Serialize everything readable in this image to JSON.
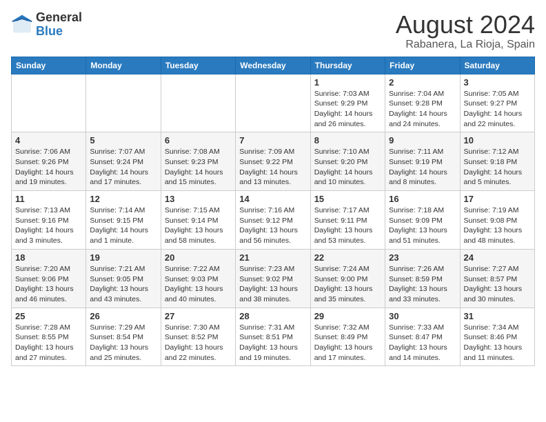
{
  "header": {
    "logo_general": "General",
    "logo_blue": "Blue",
    "month_year": "August 2024",
    "location": "Rabanera, La Rioja, Spain"
  },
  "days_of_week": [
    "Sunday",
    "Monday",
    "Tuesday",
    "Wednesday",
    "Thursday",
    "Friday",
    "Saturday"
  ],
  "weeks": [
    [
      {
        "day": "",
        "info": ""
      },
      {
        "day": "",
        "info": ""
      },
      {
        "day": "",
        "info": ""
      },
      {
        "day": "",
        "info": ""
      },
      {
        "day": "1",
        "info": "Sunrise: 7:03 AM\nSunset: 9:29 PM\nDaylight: 14 hours\nand 26 minutes."
      },
      {
        "day": "2",
        "info": "Sunrise: 7:04 AM\nSunset: 9:28 PM\nDaylight: 14 hours\nand 24 minutes."
      },
      {
        "day": "3",
        "info": "Sunrise: 7:05 AM\nSunset: 9:27 PM\nDaylight: 14 hours\nand 22 minutes."
      }
    ],
    [
      {
        "day": "4",
        "info": "Sunrise: 7:06 AM\nSunset: 9:26 PM\nDaylight: 14 hours\nand 19 minutes."
      },
      {
        "day": "5",
        "info": "Sunrise: 7:07 AM\nSunset: 9:24 PM\nDaylight: 14 hours\nand 17 minutes."
      },
      {
        "day": "6",
        "info": "Sunrise: 7:08 AM\nSunset: 9:23 PM\nDaylight: 14 hours\nand 15 minutes."
      },
      {
        "day": "7",
        "info": "Sunrise: 7:09 AM\nSunset: 9:22 PM\nDaylight: 14 hours\nand 13 minutes."
      },
      {
        "day": "8",
        "info": "Sunrise: 7:10 AM\nSunset: 9:20 PM\nDaylight: 14 hours\nand 10 minutes."
      },
      {
        "day": "9",
        "info": "Sunrise: 7:11 AM\nSunset: 9:19 PM\nDaylight: 14 hours\nand 8 minutes."
      },
      {
        "day": "10",
        "info": "Sunrise: 7:12 AM\nSunset: 9:18 PM\nDaylight: 14 hours\nand 5 minutes."
      }
    ],
    [
      {
        "day": "11",
        "info": "Sunrise: 7:13 AM\nSunset: 9:16 PM\nDaylight: 14 hours\nand 3 minutes."
      },
      {
        "day": "12",
        "info": "Sunrise: 7:14 AM\nSunset: 9:15 PM\nDaylight: 14 hours\nand 1 minute."
      },
      {
        "day": "13",
        "info": "Sunrise: 7:15 AM\nSunset: 9:14 PM\nDaylight: 13 hours\nand 58 minutes."
      },
      {
        "day": "14",
        "info": "Sunrise: 7:16 AM\nSunset: 9:12 PM\nDaylight: 13 hours\nand 56 minutes."
      },
      {
        "day": "15",
        "info": "Sunrise: 7:17 AM\nSunset: 9:11 PM\nDaylight: 13 hours\nand 53 minutes."
      },
      {
        "day": "16",
        "info": "Sunrise: 7:18 AM\nSunset: 9:09 PM\nDaylight: 13 hours\nand 51 minutes."
      },
      {
        "day": "17",
        "info": "Sunrise: 7:19 AM\nSunset: 9:08 PM\nDaylight: 13 hours\nand 48 minutes."
      }
    ],
    [
      {
        "day": "18",
        "info": "Sunrise: 7:20 AM\nSunset: 9:06 PM\nDaylight: 13 hours\nand 46 minutes."
      },
      {
        "day": "19",
        "info": "Sunrise: 7:21 AM\nSunset: 9:05 PM\nDaylight: 13 hours\nand 43 minutes."
      },
      {
        "day": "20",
        "info": "Sunrise: 7:22 AM\nSunset: 9:03 PM\nDaylight: 13 hours\nand 40 minutes."
      },
      {
        "day": "21",
        "info": "Sunrise: 7:23 AM\nSunset: 9:02 PM\nDaylight: 13 hours\nand 38 minutes."
      },
      {
        "day": "22",
        "info": "Sunrise: 7:24 AM\nSunset: 9:00 PM\nDaylight: 13 hours\nand 35 minutes."
      },
      {
        "day": "23",
        "info": "Sunrise: 7:26 AM\nSunset: 8:59 PM\nDaylight: 13 hours\nand 33 minutes."
      },
      {
        "day": "24",
        "info": "Sunrise: 7:27 AM\nSunset: 8:57 PM\nDaylight: 13 hours\nand 30 minutes."
      }
    ],
    [
      {
        "day": "25",
        "info": "Sunrise: 7:28 AM\nSunset: 8:55 PM\nDaylight: 13 hours\nand 27 minutes."
      },
      {
        "day": "26",
        "info": "Sunrise: 7:29 AM\nSunset: 8:54 PM\nDaylight: 13 hours\nand 25 minutes."
      },
      {
        "day": "27",
        "info": "Sunrise: 7:30 AM\nSunset: 8:52 PM\nDaylight: 13 hours\nand 22 minutes."
      },
      {
        "day": "28",
        "info": "Sunrise: 7:31 AM\nSunset: 8:51 PM\nDaylight: 13 hours\nand 19 minutes."
      },
      {
        "day": "29",
        "info": "Sunrise: 7:32 AM\nSunset: 8:49 PM\nDaylight: 13 hours\nand 17 minutes."
      },
      {
        "day": "30",
        "info": "Sunrise: 7:33 AM\nSunset: 8:47 PM\nDaylight: 13 hours\nand 14 minutes."
      },
      {
        "day": "31",
        "info": "Sunrise: 7:34 AM\nSunset: 8:46 PM\nDaylight: 13 hours\nand 11 minutes."
      }
    ]
  ]
}
